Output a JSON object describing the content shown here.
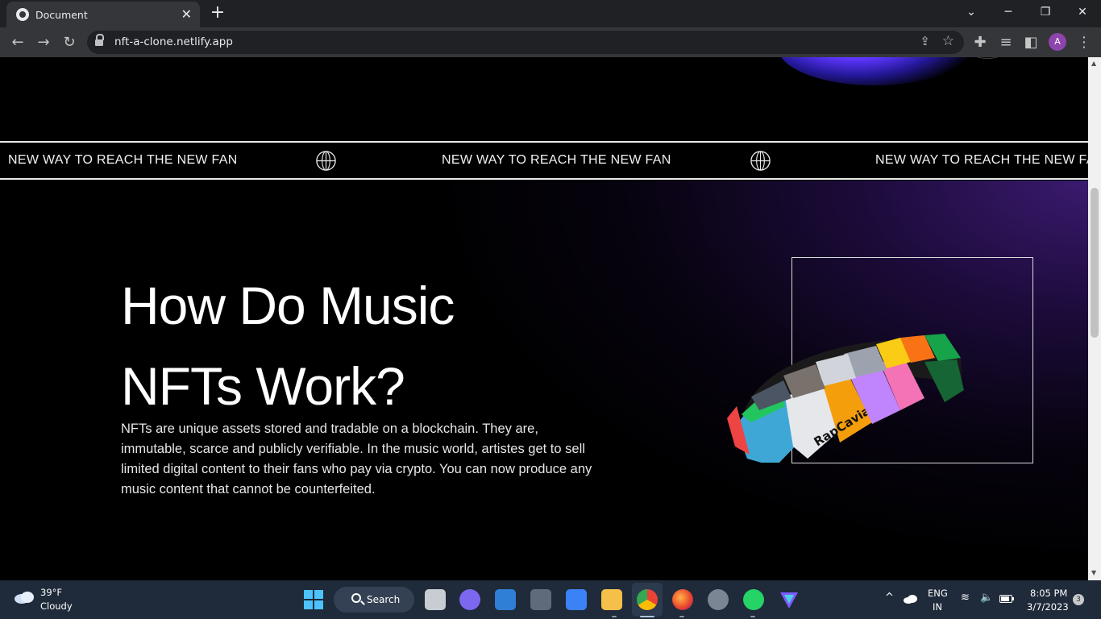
{
  "browser": {
    "tab_title": "Document",
    "url": "nft-a-clone.netlify.app",
    "profile_initial": "A"
  },
  "marquee": {
    "items": [
      "NEW WAY TO REACH THE NEW FAN",
      "NEW WAY TO REACH THE NEW FAN",
      "NEW WAY TO REACH THE NEW FAN"
    ]
  },
  "section": {
    "heading": "How Do Music\nNFTs Work?",
    "body": "NFTs are unique assets stored and tradable on a blockchain. They are, immutable, scarce and publicly verifiable. In the music world, artistes get to sell limited digital content to their fans who pay via crypto. You can now produce any music content that cannot be counterfeited."
  },
  "taskbar": {
    "weather_temp": "39°F",
    "weather_cond": "Cloudy",
    "search_label": "Search",
    "lang_line1": "ENG",
    "lang_line2": "IN",
    "time": "8:05 PM",
    "date": "3/7/2023",
    "notification_count": "3"
  },
  "colors": {
    "accent_purple": "#3a1a6e",
    "page_bg": "#000000",
    "taskbar_bg": "#1f2a3a"
  }
}
